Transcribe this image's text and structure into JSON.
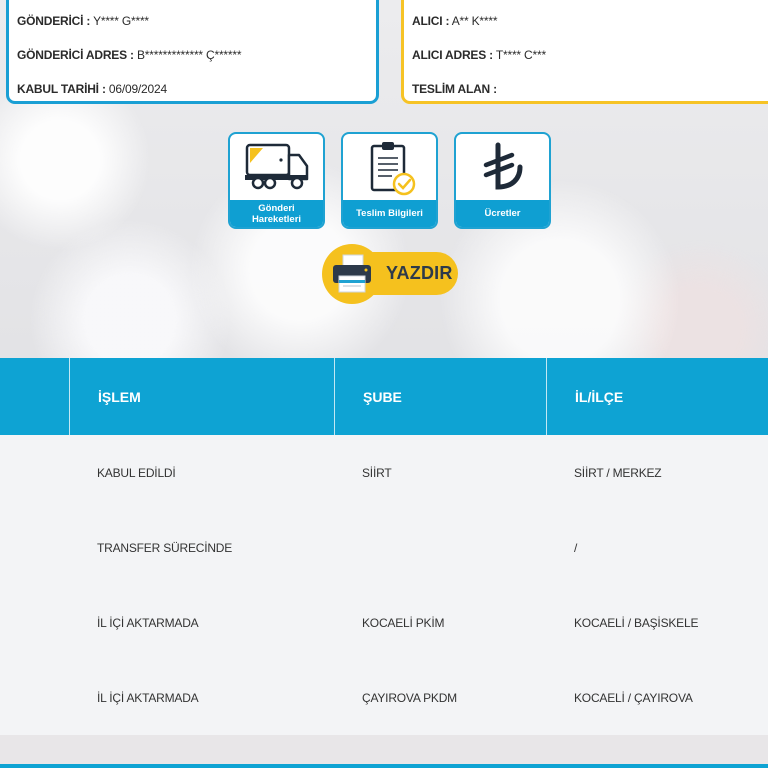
{
  "sender_card": {
    "sender_label": "GÖNDERİCİ :",
    "sender_value": "Y**** G****",
    "address_label": "GÖNDERİCİ ADRES :",
    "address_value": "B************* Ç******",
    "date_label": "KABUL TARİHİ :",
    "date_value": "06/09/2024"
  },
  "receiver_card": {
    "receiver_label": "ALICI :",
    "receiver_value": "A** K****",
    "address_label": "ALICI ADRES :",
    "address_value": "T**** C***",
    "delivered_label": "TESLİM ALAN :",
    "delivered_value": ""
  },
  "tiles": [
    {
      "label": "Gönderi Hareketleri",
      "icon": "truck-icon"
    },
    {
      "label": "Teslim Bilgileri",
      "icon": "clipboard-check-icon"
    },
    {
      "label": "Ücretler",
      "icon": "lira-icon"
    }
  ],
  "print_button": {
    "label": "YAZDIR",
    "icon": "printer-icon"
  },
  "colors": {
    "blue": "#0ea3d3",
    "yellow": "#f5c11e",
    "text": "#2b2b2b"
  },
  "table": {
    "headers": [
      "",
      "İŞLEM",
      "ŞUBE",
      "İL/İLÇE"
    ],
    "rows": [
      [
        "KABUL EDİLDİ",
        "SİİRT",
        "SİİRT / MERKEZ"
      ],
      [
        "TRANSFER SÜRECİNDE",
        "",
        "/"
      ],
      [
        "İL İÇİ AKTARMADA",
        "KOCAELİ PKİM",
        "KOCAELİ / BAŞİSKELE"
      ],
      [
        "İL İÇİ AKTARMADA",
        "ÇAYIROVA PKDM",
        "KOCAELİ / ÇAYIROVA"
      ]
    ]
  }
}
